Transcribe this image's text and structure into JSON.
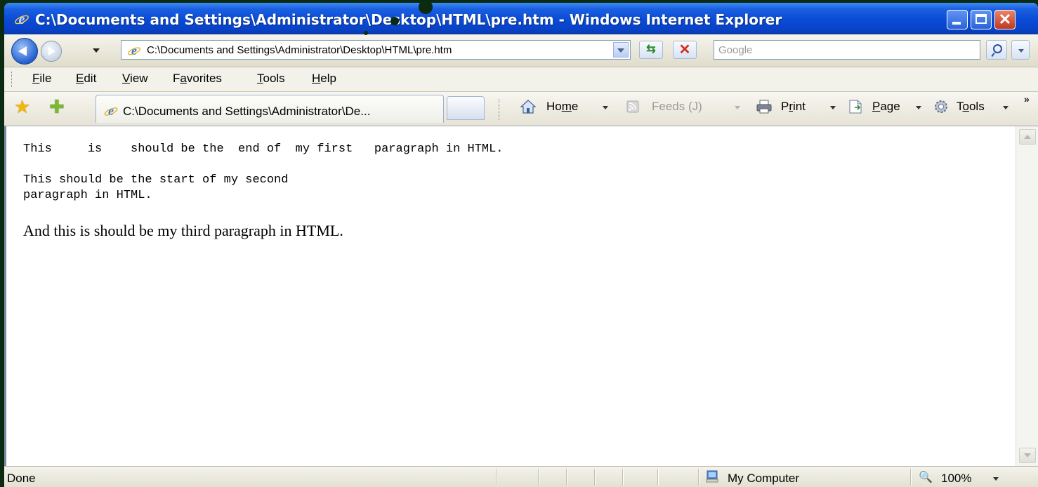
{
  "window": {
    "title": "C:\\Documents and Settings\\Administrator\\Desktop\\HTML\\pre.htm - Windows Internet Explorer",
    "accent": "#0a4ad6"
  },
  "address_bar": {
    "url": "C:\\Documents and Settings\\Administrator\\Desktop\\HTML\\pre.htm",
    "search_placeholder": "Google"
  },
  "menu": {
    "items": [
      {
        "pre": "",
        "u": "F",
        "post": "ile"
      },
      {
        "pre": "",
        "u": "E",
        "post": "dit"
      },
      {
        "pre": "",
        "u": "V",
        "post": "iew"
      },
      {
        "pre": "F",
        "u": "a",
        "post": "vorites"
      },
      {
        "pre": "",
        "u": "T",
        "post": "ools"
      },
      {
        "pre": "",
        "u": "H",
        "post": "elp"
      }
    ]
  },
  "tabs": {
    "active_label": "C:\\Documents and Settings\\Administrator\\De..."
  },
  "commands": {
    "home": {
      "pre": "Ho",
      "u": "m",
      "post": "e"
    },
    "feeds": "Feeds (J)",
    "print": {
      "pre": "P",
      "u": "r",
      "post": "int"
    },
    "page": {
      "pre": "",
      "u": "P",
      "post": "age"
    },
    "tools": {
      "pre": "T",
      "u": "o",
      "post": "ols"
    }
  },
  "content": {
    "pre1": "This     is    should be the  end of  my first   paragraph in HTML.",
    "pre2": "This should be the start of my second\nparagraph in HTML.",
    "para3": "And this is should be my third paragraph in HTML."
  },
  "status": {
    "text": "Done",
    "zone": "My Computer",
    "zoom": "100%"
  }
}
